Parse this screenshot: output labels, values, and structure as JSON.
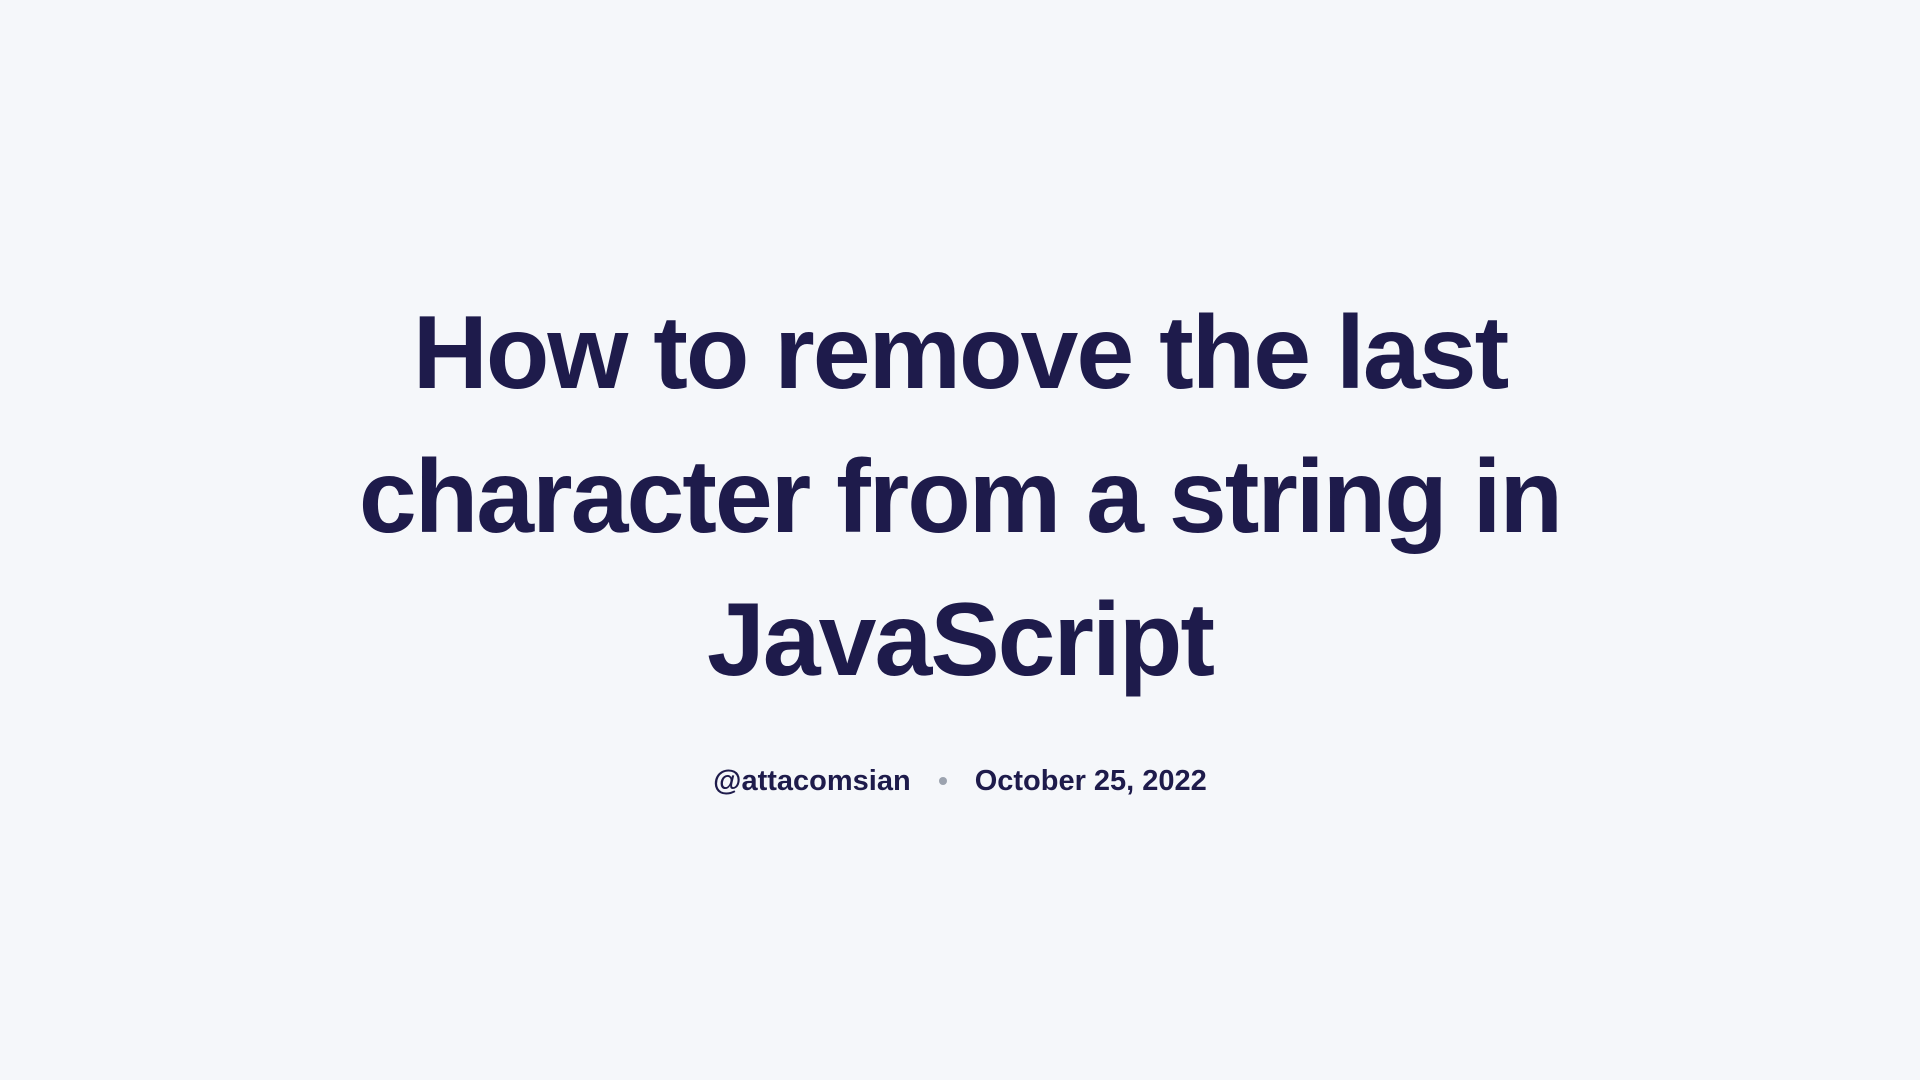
{
  "title": "How to remove the last character from a string in JavaScript",
  "author": "@attacomsian",
  "date": "October 25, 2022"
}
